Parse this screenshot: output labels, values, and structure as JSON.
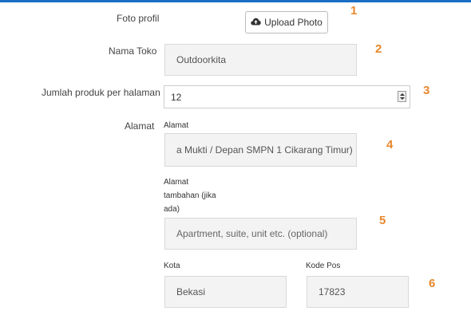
{
  "form": {
    "photo_label": "Foto profil",
    "upload_button": "Upload Photo",
    "store_name_label": "Nama Toko",
    "store_name_value": "Outdoorkita",
    "per_page_label": "Jumlah produk per halaman",
    "per_page_value": "12",
    "address_label": "Alamat",
    "address_sub_label": "Alamat",
    "address_value": "a Mukti / Depan SMPN 1 Cikarang Timur)",
    "address2_label_line1": "Alamat",
    "address2_label_line2": "tambahan (jika",
    "address2_label_line3": "ada)",
    "address2_placeholder": "Apartment, suite, unit etc. (optional)",
    "city_label": "Kota",
    "city_value": "Bekasi",
    "postcode_label": "Kode Pos",
    "postcode_value": "17823"
  },
  "annotations": [
    "1",
    "2",
    "3",
    "4",
    "5",
    "6"
  ],
  "colors": {
    "accent_bar": "#1a6fc4",
    "annotation": "#e8872c"
  },
  "icons": {
    "upload": "cloud-upload-icon"
  }
}
